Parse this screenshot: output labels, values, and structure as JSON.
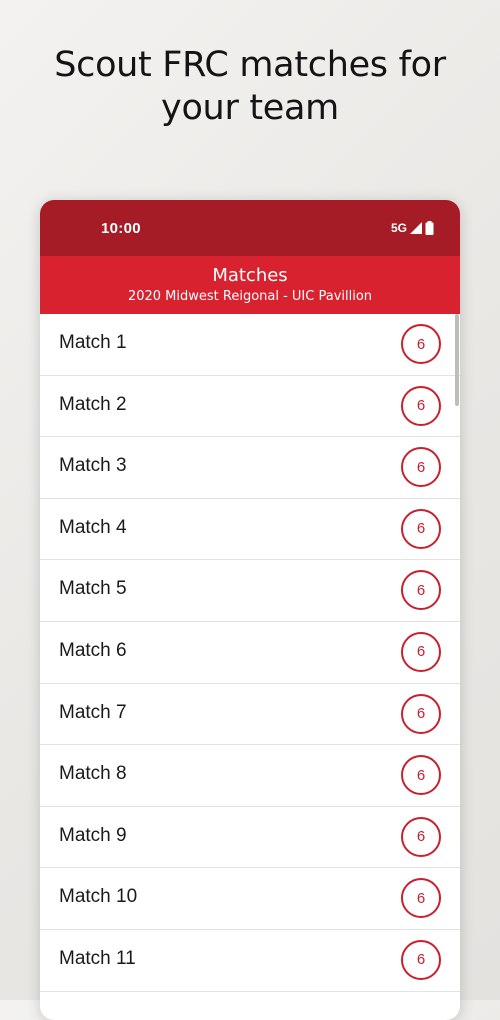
{
  "headline": {
    "line1": "Scout FRC matches for",
    "line2": "your team"
  },
  "status_bar": {
    "time": "10:00",
    "network": "5G",
    "icons": [
      "signal-icon",
      "battery-icon"
    ]
  },
  "app_bar": {
    "title": "Matches",
    "subtitle": "2020 Midwest Reigonal - UIC Pavillion"
  },
  "matches": [
    {
      "label": "Match 1",
      "team_count": "6"
    },
    {
      "label": "Match 2",
      "team_count": "6"
    },
    {
      "label": "Match 3",
      "team_count": "6"
    },
    {
      "label": "Match 4",
      "team_count": "6"
    },
    {
      "label": "Match 5",
      "team_count": "6"
    },
    {
      "label": "Match 6",
      "team_count": "6"
    },
    {
      "label": "Match 7",
      "team_count": "6"
    },
    {
      "label": "Match 8",
      "team_count": "6"
    },
    {
      "label": "Match 9",
      "team_count": "6"
    },
    {
      "label": "Match 10",
      "team_count": "6"
    },
    {
      "label": "Match 11",
      "team_count": "6"
    }
  ],
  "colors": {
    "status_bar": "#a61c26",
    "app_bar": "#d8222f",
    "accent": "#c8202d",
    "background": "#ecebe9"
  }
}
